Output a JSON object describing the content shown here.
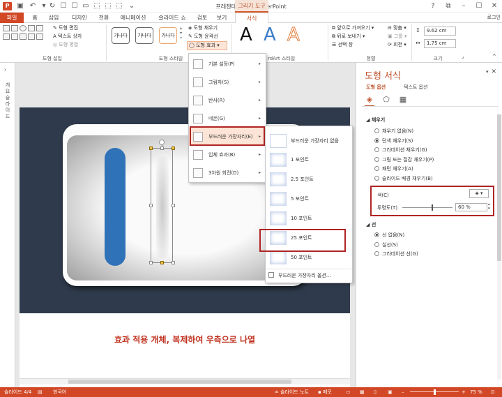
{
  "window": {
    "title": "프레젠테이션1 - PowerPoint",
    "context_tab": "그리기 도구",
    "login": "로그인",
    "logo_letter": "P"
  },
  "tabs": [
    "파일",
    "홈",
    "삽입",
    "디자인",
    "전환",
    "애니메이션",
    "슬라이드 쇼",
    "검토",
    "보기",
    "서식"
  ],
  "ribbon": {
    "insert_shapes": {
      "edit_shape": "도형 편집",
      "text_box": "텍스트 상자",
      "merge_shapes": "도형 병합",
      "label": "도형 삽입"
    },
    "shape_styles": {
      "preset_text": "가나다",
      "fill": "도형 채우기",
      "outline": "도형 윤곽선",
      "effects": "도형 효과",
      "label": "도형 스타일"
    },
    "wordart": {
      "letter": "A",
      "label": "rdArt 스타일"
    },
    "arrange": {
      "bring_forward": "앞으로 가져오기",
      "send_backward": "뒤로 보내기",
      "selection_pane": "선택 창",
      "align": "맞춤",
      "group": "그룹",
      "rotate": "회전",
      "label": "정렬"
    },
    "size": {
      "height": "9.62 cm",
      "width": "1.75 cm",
      "label": "크기"
    }
  },
  "leftrail": {
    "text": "개요 슬라이드"
  },
  "slide": {
    "caption": "효과 적용 개체, 복제하여 우측으로 나열"
  },
  "effects_menu": {
    "items": [
      {
        "label": "기본 설정(P)",
        "highlighted": false
      },
      {
        "label": "그림자(S)",
        "highlighted": false
      },
      {
        "label": "반사(R)",
        "highlighted": false
      },
      {
        "label": "네온(G)",
        "highlighted": false
      },
      {
        "label": "부드러운 가장자리(E)",
        "highlighted": true
      },
      {
        "label": "입체 효과(B)",
        "highlighted": false
      },
      {
        "label": "3차원 회전(D)",
        "highlighted": false
      }
    ]
  },
  "soft_edges_submenu": {
    "header": "부드러운 가장자리 없음",
    "items": [
      "1 포인트",
      "2.5 포인트",
      "5 포인트",
      "10 포인트",
      "25 포인트",
      "50 포인트"
    ],
    "selected": "25 포인트",
    "options_link": "부드러운 가장자리 옵션..."
  },
  "format_pane": {
    "title": "도형 서식",
    "tab_shape": "도형 옵션",
    "tab_text": "텍스트 옵션",
    "fill": {
      "heading": "채우기",
      "options": [
        {
          "label": "채우기 없음(N)",
          "selected": false
        },
        {
          "label": "단색 채우기(S)",
          "selected": true
        },
        {
          "label": "그라데이션 채우기(G)",
          "selected": false
        },
        {
          "label": "그림 또는 질감 채우기(P)",
          "selected": false
        },
        {
          "label": "패턴 채우기(A)",
          "selected": false
        },
        {
          "label": "슬라이드 배경 채우기(B)",
          "selected": false
        }
      ],
      "color_label": "색(C)",
      "transparency_label": "투명도(T)",
      "transparency_value": "60 %",
      "transparency_level": 0.6
    },
    "line": {
      "heading": "선",
      "options": [
        {
          "label": "선 없음(N)",
          "selected": true
        },
        {
          "label": "실선(S)",
          "selected": false
        },
        {
          "label": "그라데이션 선(G)",
          "selected": false
        }
      ]
    }
  },
  "statusbar": {
    "slide": "슬라이드 4/4",
    "language": "한국어",
    "notes": "슬라이드 노트",
    "comments": "메모",
    "zoom": "75 %"
  },
  "colors": {
    "accent": "#d24726",
    "slide_dark": "#2f3b4c",
    "shape_blue": "#2f72b8",
    "highlight_red": "#b02424",
    "caption_red": "#c0321f"
  }
}
